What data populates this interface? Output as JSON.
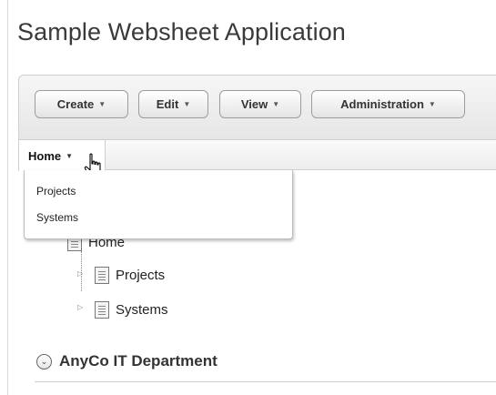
{
  "app": {
    "title": "Sample Websheet Application"
  },
  "toolbar": {
    "buttons": [
      {
        "label": "Create",
        "caret": "▼"
      },
      {
        "label": "Edit",
        "caret": "▼"
      },
      {
        "label": "View",
        "caret": "▼"
      },
      {
        "label": "Administration",
        "caret": "▼"
      }
    ]
  },
  "tabs": {
    "home": {
      "label": "Home",
      "caret": "▼"
    }
  },
  "dropdown": {
    "items": [
      {
        "label": "Projects"
      },
      {
        "label": "Systems"
      }
    ]
  },
  "tree": {
    "root": {
      "label": "Home"
    },
    "children": [
      {
        "label": "Projects"
      },
      {
        "label": "Systems"
      }
    ]
  },
  "section": {
    "title": "AnyCo IT Department",
    "toggle_icon": "⌄"
  },
  "icons": {
    "cursor": "hand-pointer-icon",
    "page": "document-icon"
  }
}
